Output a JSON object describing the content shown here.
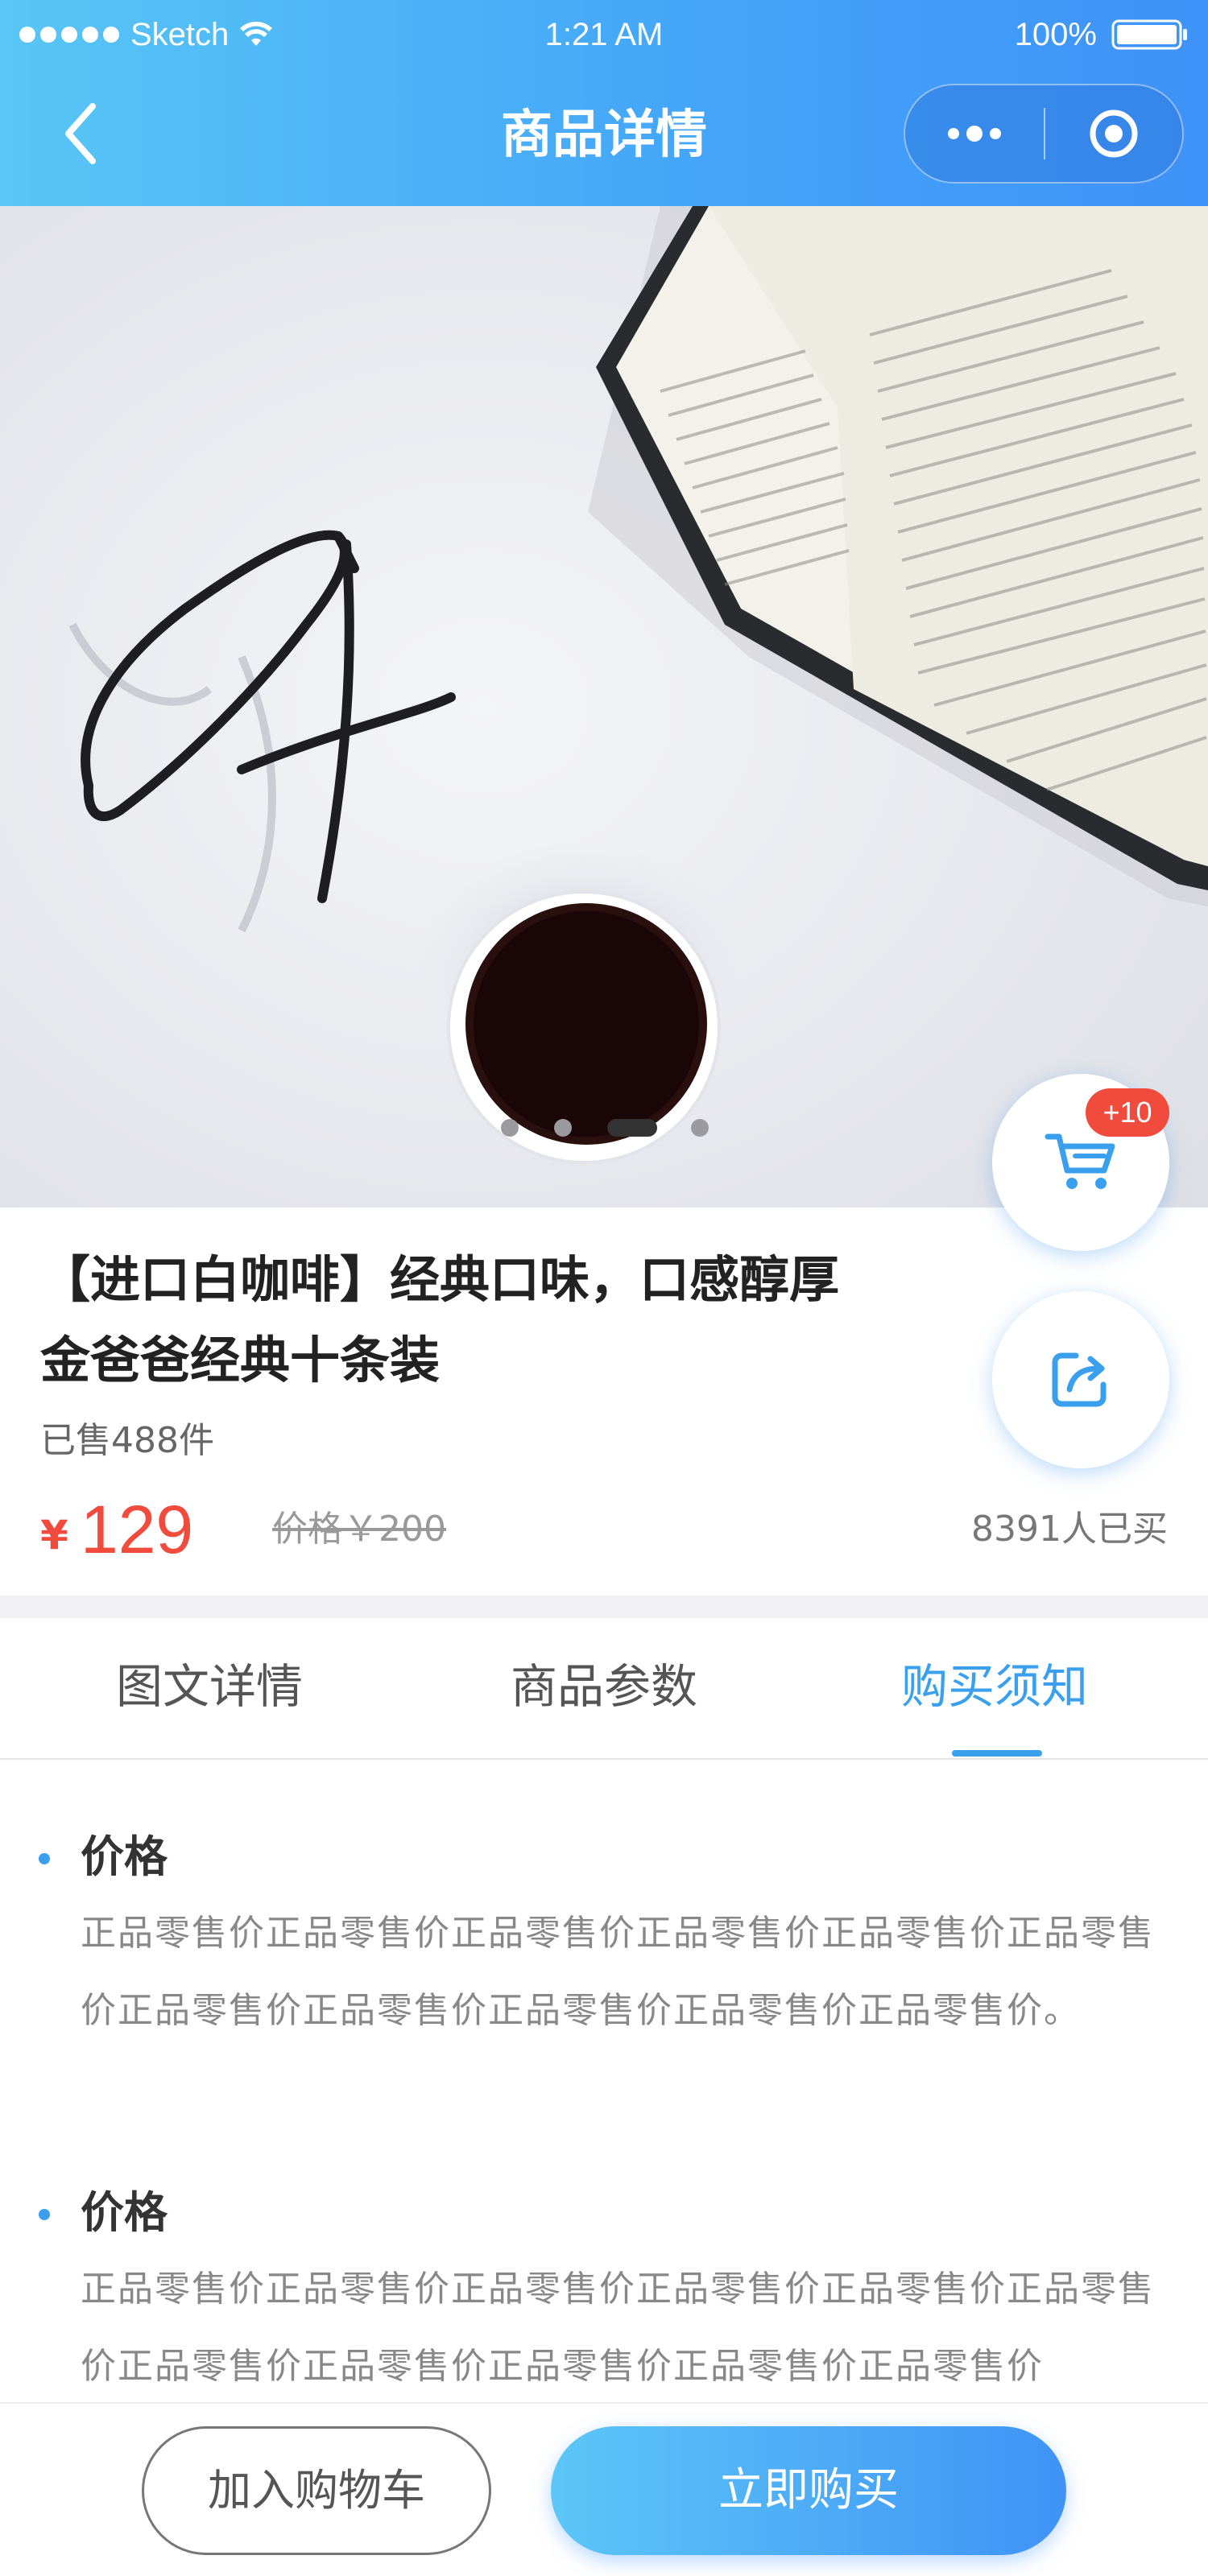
{
  "status_bar": {
    "carrier": "Sketch",
    "time": "1:21 AM",
    "battery": "100%"
  },
  "nav": {
    "title": "商品详情",
    "back_icon": "chevron-left-icon",
    "more_icon": "more-dots-icon",
    "target_icon": "target-circle-icon"
  },
  "carousel": {
    "image": "glasses-coffee-book-photo",
    "dot_count": 4,
    "active_index": 2
  },
  "cart": {
    "badge": "+10",
    "icon": "cart-icon"
  },
  "share": {
    "icon": "share-icon"
  },
  "product": {
    "title_line1": "【进口白咖啡】经典口味，口感醇厚",
    "title_line2": "金爸爸经典十条装",
    "sold": "已售488件",
    "currency": "¥",
    "price": "129",
    "original_price": "价格￥200",
    "buyers": "8391人已买"
  },
  "tabs": [
    {
      "label": "图文详情",
      "active": false
    },
    {
      "label": "商品参数",
      "active": false
    },
    {
      "label": "购买须知",
      "active": true
    }
  ],
  "sections": [
    {
      "heading": "价格",
      "body": "正品零售价正品零售价正品零售价正品零售价正品零售价正品零售价正品零售价正品零售价正品零售价正品零售价正品零售价。"
    },
    {
      "heading": "价格",
      "body": "正品零售价正品零售价正品零售价正品零售价正品零售价正品零售价正品零售价正品零售价正品零售价正品零售价正品零售价"
    }
  ],
  "bottom_bar": {
    "add_to_cart": "加入购物车",
    "buy_now": "立即购买"
  },
  "colors": {
    "accent": "#3aa0ee",
    "price": "#f04b3d",
    "header_start": "#58c6f6",
    "header_end": "#3f92f7"
  }
}
